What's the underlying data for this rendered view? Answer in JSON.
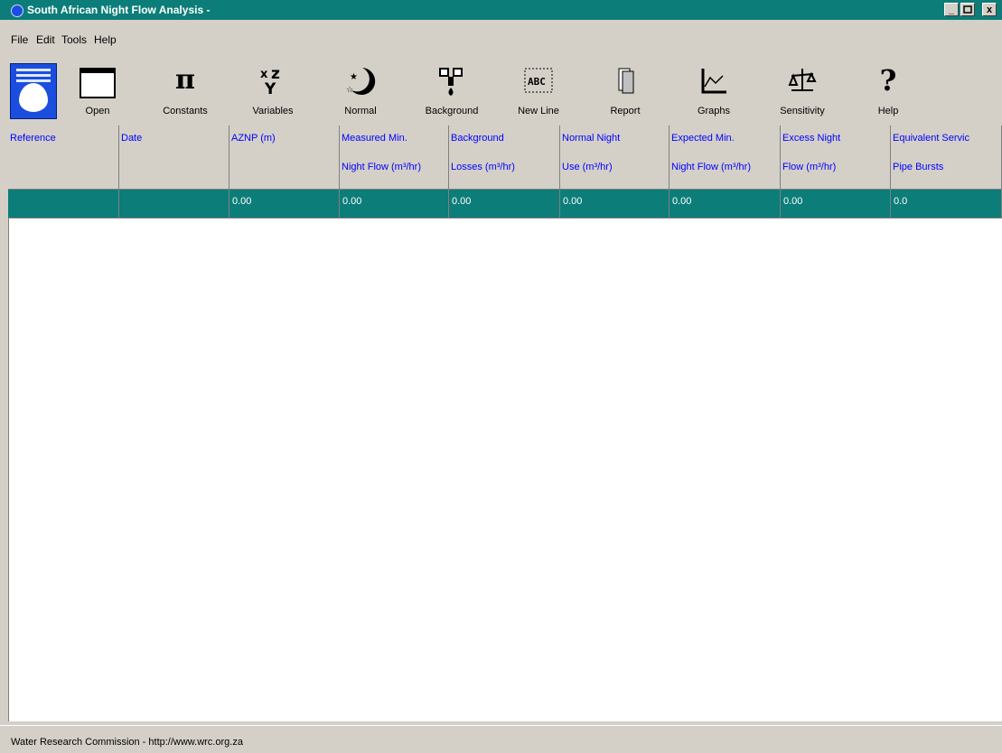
{
  "window": {
    "title": "South African Night Flow Analysis -"
  },
  "window_controls": {
    "minimize": "_",
    "maximize": "̲□",
    "close": "x"
  },
  "menu": [
    "File",
    "Edit",
    "Tools",
    "Help"
  ],
  "toolbar": {
    "buttons": [
      {
        "label": "Open",
        "icon": "folder-icon"
      },
      {
        "label": "Constants",
        "icon": "pi-icon"
      },
      {
        "label": "Variables",
        "icon": "xyz-icon"
      },
      {
        "label": "Normal",
        "icon": "moon-stars-icon"
      },
      {
        "label": "Background",
        "icon": "tap-drip-icon"
      },
      {
        "label": "New Line",
        "icon": "new-line-icon"
      },
      {
        "label": "Report",
        "icon": "report-icon"
      },
      {
        "label": "Graphs",
        "icon": "graph-icon"
      },
      {
        "label": "Sensitivity",
        "icon": "scale-icon"
      },
      {
        "label": "Help",
        "icon": "question-icon"
      }
    ],
    "icon_glyphs": {
      "pi": "π",
      "xy": "xy",
      "z": "z",
      "question": "?"
    }
  },
  "table": {
    "headers": [
      {
        "line1": "Reference",
        "line2": ""
      },
      {
        "line1": "Date",
        "line2": ""
      },
      {
        "line1": "AZNP (m)",
        "line2": ""
      },
      {
        "line1": "Measured Min.",
        "line2": "Night Flow (m³/hr)"
      },
      {
        "line1": "Background",
        "line2": "Losses (m³/hr)"
      },
      {
        "line1": "Normal Night",
        "line2": "Use (m³/hr)"
      },
      {
        "line1": "Expected Min.",
        "line2": "Night Flow (m³/hr)"
      },
      {
        "line1": "Excess Night",
        "line2": "Flow (m³/hr)"
      },
      {
        "line1": "Equivalent Servic",
        "line2": "Pipe Bursts"
      }
    ],
    "row": [
      "",
      "",
      "0.00",
      "0.00",
      "0.00",
      "0.00",
      "0.00",
      "0.00",
      "0.0"
    ]
  },
  "status": {
    "text": "Water Research Commission - http://www.wrc.org.za"
  },
  "colors": {
    "titlebar": "#0c7d78",
    "header_text": "#0000ff",
    "selected_row": "#0c7d78",
    "logo": "#1b4ddf"
  }
}
